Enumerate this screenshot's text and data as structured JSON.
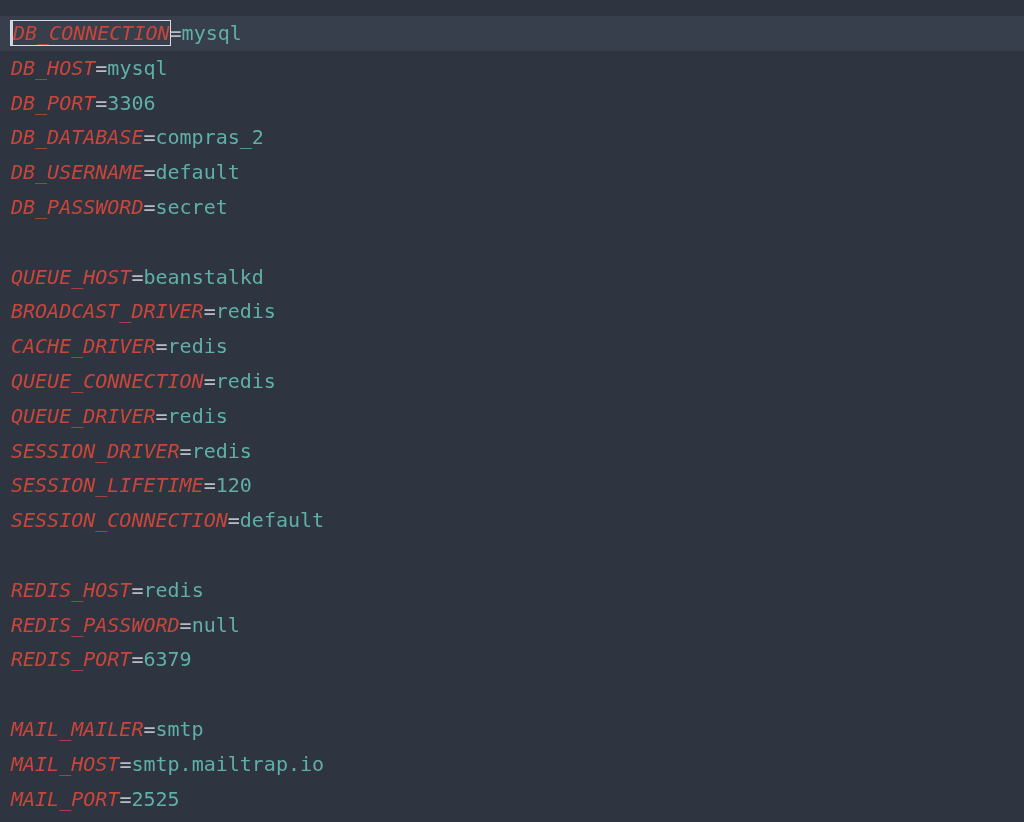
{
  "editor": {
    "groups": [
      {
        "entries": [
          {
            "key": "DB_CONNECTION",
            "sep": "=",
            "value": "mysql",
            "selected": true
          },
          {
            "key": "DB_HOST",
            "sep": "=",
            "value": "mysql",
            "selected": false
          },
          {
            "key": "DB_PORT",
            "sep": "=",
            "value": "3306",
            "selected": false
          },
          {
            "key": "DB_DATABASE",
            "sep": "=",
            "value": "compras_2",
            "selected": false
          },
          {
            "key": "DB_USERNAME",
            "sep": "=",
            "value": "default",
            "selected": false
          },
          {
            "key": "DB_PASSWORD",
            "sep": "=",
            "value": "secret",
            "selected": false
          }
        ]
      },
      {
        "entries": [
          {
            "key": "QUEUE_HOST",
            "sep": "=",
            "value": "beanstalkd",
            "selected": false
          },
          {
            "key": "BROADCAST_DRIVER",
            "sep": "=",
            "value": "redis",
            "selected": false
          },
          {
            "key": "CACHE_DRIVER",
            "sep": "=",
            "value": "redis",
            "selected": false
          },
          {
            "key": "QUEUE_CONNECTION",
            "sep": "=",
            "value": "redis",
            "selected": false
          },
          {
            "key": "QUEUE_DRIVER",
            "sep": "=",
            "value": "redis",
            "selected": false
          },
          {
            "key": "SESSION_DRIVER",
            "sep": "=",
            "value": "redis",
            "selected": false
          },
          {
            "key": "SESSION_LIFETIME",
            "sep": "=",
            "value": "120",
            "selected": false
          },
          {
            "key": "SESSION_CONNECTION",
            "sep": "=",
            "value": "default",
            "selected": false
          }
        ]
      },
      {
        "entries": [
          {
            "key": "REDIS_HOST",
            "sep": "=",
            "value": "redis",
            "selected": false
          },
          {
            "key": "REDIS_PASSWORD",
            "sep": "=",
            "value": "null",
            "selected": false
          },
          {
            "key": "REDIS_PORT",
            "sep": "=",
            "value": "6379",
            "selected": false
          }
        ]
      },
      {
        "entries": [
          {
            "key": "MAIL_MAILER",
            "sep": "=",
            "value": "smtp",
            "selected": false
          },
          {
            "key": "MAIL_HOST",
            "sep": "=",
            "value": "smtp.mailtrap.io",
            "selected": false
          },
          {
            "key": "MAIL_PORT",
            "sep": "=",
            "value": "2525",
            "selected": false
          }
        ]
      }
    ]
  }
}
